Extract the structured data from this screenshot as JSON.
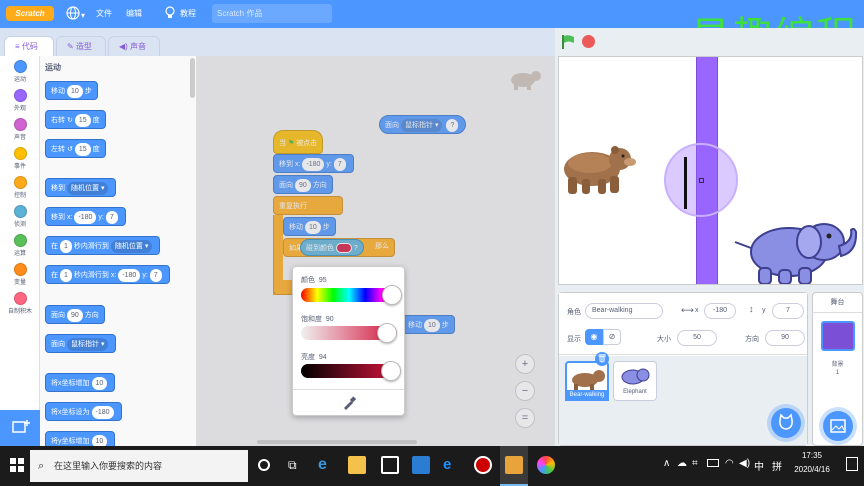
{
  "menubar": {
    "logo": "Scratch",
    "file": "文件",
    "edit": "编辑",
    "tutorials": "教程",
    "project_title": "Scratch 作品"
  },
  "watermark": "易趣编程",
  "tabs": {
    "code": "代码",
    "costumes": "造型",
    "sounds": "声音"
  },
  "categories": [
    {
      "label": "运动",
      "color": "#4c97ff"
    },
    {
      "label": "外观",
      "color": "#9966ff"
    },
    {
      "label": "声音",
      "color": "#cf63cf"
    },
    {
      "label": "事件",
      "color": "#ffbf00"
    },
    {
      "label": "控制",
      "color": "#ffab19"
    },
    {
      "label": "侦测",
      "color": "#5cb1d6"
    },
    {
      "label": "运算",
      "color": "#59c059"
    },
    {
      "label": "变量",
      "color": "#ff8c1a"
    },
    {
      "label": "自制积木",
      "color": "#ff6680"
    }
  ],
  "palette": {
    "section_title": "运动",
    "move": "移动",
    "move_val": "10",
    "steps": "步",
    "turn_right": "右转",
    "turn_right_val": "15",
    "degrees": "度",
    "turn_left": "左转",
    "turn_left_val": "15",
    "goto": "移到",
    "goto_target": "随机位置",
    "goto_xy": "移到 x:",
    "goto_x": "-180",
    "y_label": "y:",
    "goto_y": "7",
    "glide": "在",
    "glide_sec": "1",
    "glide_mid": "秒内滑行到",
    "glide_target": "随机位置",
    "glide2_x_label": "秒内滑行到 x:",
    "glide2_x": "-180",
    "glide2_y": "7",
    "point": "面向",
    "point_val": "90",
    "direction": "方向",
    "point_towards": "面向",
    "point_towards_target": "鼠标指针",
    "change_x": "将x坐标增加",
    "change_x_val": "10",
    "set_x": "将x坐标设为",
    "set_x_val": "-180",
    "change_y": "将y坐标增加",
    "change_y_val": "10"
  },
  "script": {
    "hat": "当",
    "hat_suffix": "被点击",
    "goto_xy": "移到 x:",
    "x": "-180",
    "y_label": "y:",
    "y": "7",
    "point": "面向",
    "point_val": "90",
    "direction": "方向",
    "forever": "重复执行",
    "move": "移动",
    "move_val": "10",
    "steps": "步",
    "if": "如果",
    "touching_color": "碰到颜色",
    "question": "?",
    "then": "那么",
    "floating_turn": "面向",
    "floating_target": "鼠标指针",
    "floating_move": "移动",
    "floating_move_val": "10",
    "floating_steps": "步"
  },
  "color_picker": {
    "hue_label": "颜色",
    "hue_val": "95",
    "saturation_label": "饱和度",
    "saturation_val": "90",
    "brightness_label": "亮度",
    "brightness_val": "94",
    "selected_color": "#d4143c",
    "hue_level": 0.95,
    "saturation_level": 0.9,
    "brightness_level": 0.94
  },
  "zoom": {
    "in": "+",
    "out": "−",
    "reset": "="
  },
  "sprite_info": {
    "sprite_label": "角色",
    "sprite_name": "Bear-walking",
    "x_label": "x",
    "x_val": "-180",
    "y_label": "y",
    "y_val": "7",
    "show_label": "显示",
    "size_label": "大小",
    "size_val": "50",
    "direction_label": "方向",
    "direction_val": "90"
  },
  "sprites": [
    {
      "name": "Bear-walking",
      "selected": true
    },
    {
      "name": "Elephant",
      "selected": false
    }
  ],
  "stage_panel": {
    "title": "舞台",
    "backdrop_label": "背景",
    "backdrop_count": "1"
  },
  "taskbar": {
    "search_placeholder": "在这里输入你要搜索的内容",
    "time": "17:35",
    "date": "2020/4/16",
    "ime": "中",
    "ime_mode": "拼"
  }
}
